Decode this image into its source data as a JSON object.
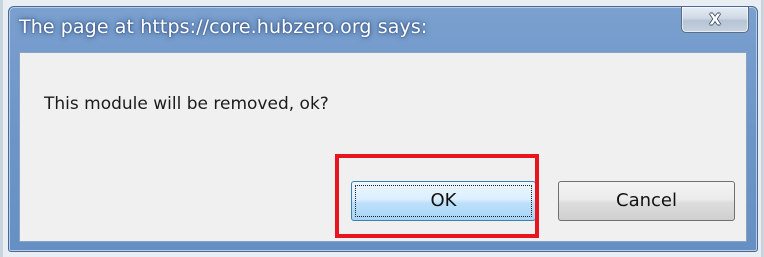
{
  "dialog": {
    "title": "The page at https://core.hubzero.org says:",
    "close_icon_glyph": "X",
    "message": "This module will be removed, ok?",
    "buttons": {
      "ok_label": "OK",
      "cancel_label": "Cancel"
    }
  },
  "annotation": {
    "highlight_color": "#e8151f",
    "highlighted_element": "ok-button"
  },
  "colors": {
    "titlebar": "#6d95c8",
    "content_background": "#f0f0f0",
    "ok_button": "#bde0fa"
  }
}
